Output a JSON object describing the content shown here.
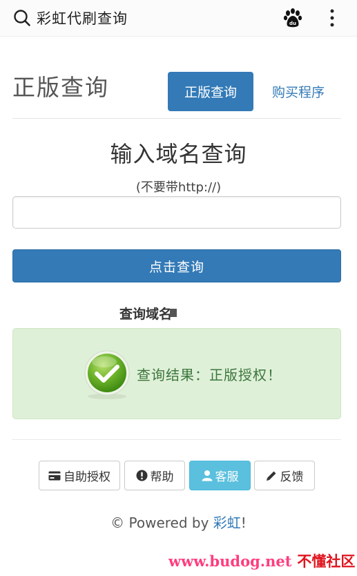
{
  "topbar": {
    "title": "彩虹代刷查询",
    "search_icon": "search-icon",
    "baidu_icon": "baidu-paw-icon",
    "more_icon": "more-vertical-icon"
  },
  "header": {
    "heading": "正版查询",
    "tab_active": "正版查询",
    "tab_buy": "购买程序"
  },
  "form": {
    "title": "输入域名查询",
    "hint": "(不要带http://)",
    "input_value": "",
    "input_placeholder": "",
    "submit_label": "点击查询"
  },
  "result": {
    "domain_label": "查询域名",
    "message": "查询结果：正版授权！",
    "icon": "check-circle-icon"
  },
  "footer": {
    "buttons": [
      {
        "label": "自助授权",
        "icon": "credit-card-icon"
      },
      {
        "label": "帮助",
        "icon": "exclamation-circle-icon"
      },
      {
        "label": "客服",
        "icon": "user-icon"
      },
      {
        "label": "反馈",
        "icon": "pencil-icon"
      }
    ],
    "powered_prefix": "© Powered by ",
    "powered_brand": "彩虹",
    "powered_suffix": "!"
  },
  "watermark": {
    "url": "www.budog.net",
    "cn": "不懂社区"
  },
  "colors": {
    "primary": "#337ab7",
    "info": "#5bc0de",
    "success_bg": "#dff0d8",
    "success_text": "#3c763d"
  }
}
